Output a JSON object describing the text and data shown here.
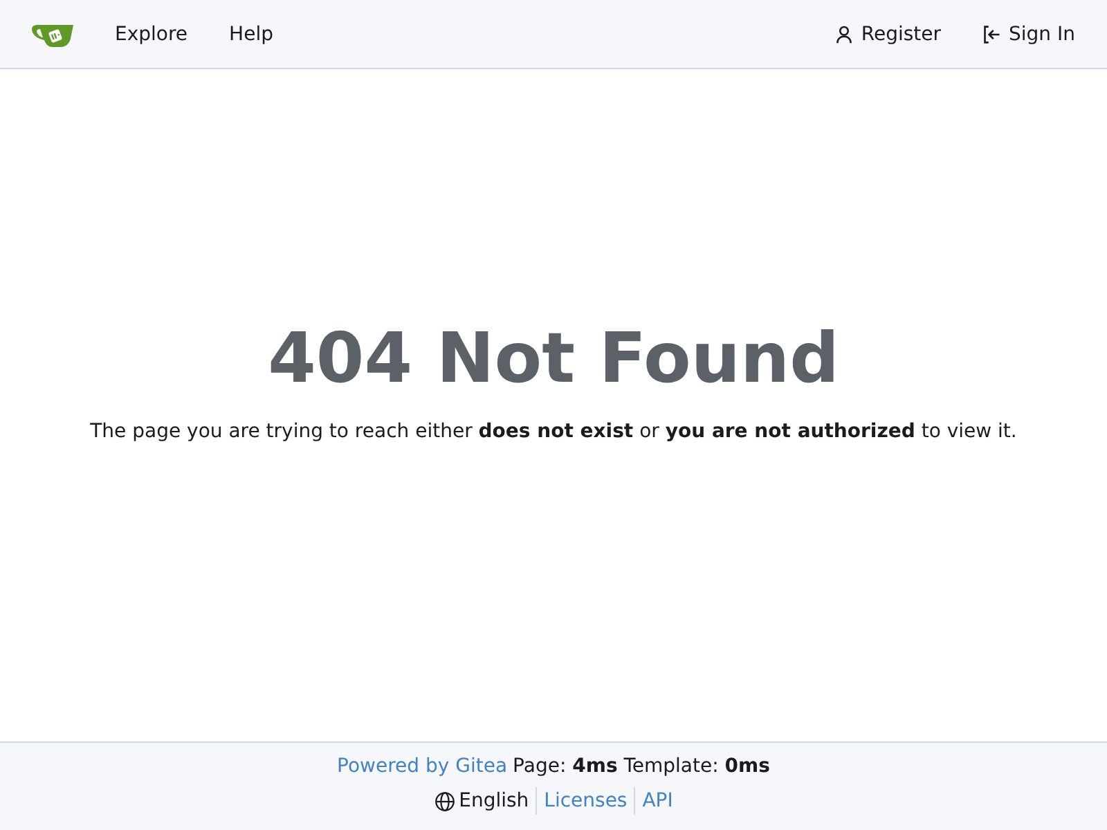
{
  "nav": {
    "left": [
      {
        "label": "Explore"
      },
      {
        "label": "Help"
      }
    ],
    "right": [
      {
        "label": "Register",
        "kind": "register"
      },
      {
        "label": "Sign In",
        "kind": "signin"
      }
    ]
  },
  "main": {
    "title": "404 Not Found",
    "message": "The page you are trying to reach either **does not exist** or **you are not authorized** to view it."
  },
  "footer": {
    "powered": "Powered by Gitea",
    "stats": "Page: **4ms** Template: **0ms**",
    "links": [
      {
        "label": "English",
        "kind": "language"
      },
      {
        "label": "Licenses",
        "kind": "link"
      },
      {
        "label": "API",
        "kind": "link"
      }
    ]
  }
}
